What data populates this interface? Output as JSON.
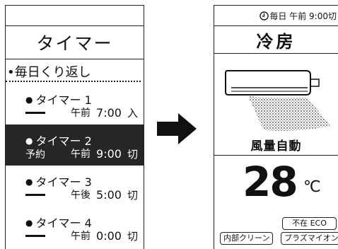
{
  "timer_screen": {
    "title": "タイマー",
    "repeat_label": "•毎日くり返し",
    "timers": [
      {
        "name": "タイマー 1",
        "reserve": "",
        "ampm": "午前",
        "time": "7:00",
        "action": "入",
        "selected": false
      },
      {
        "name": "タイマー 2",
        "reserve": "予約",
        "ampm": "午前",
        "time": "9:00",
        "action": "切",
        "selected": true
      },
      {
        "name": "タイマー 3",
        "reserve": "",
        "ampm": "午後",
        "time": "5:00",
        "action": "切",
        "selected": false
      },
      {
        "name": "タイマー 4",
        "reserve": "",
        "ampm": "午前",
        "time": "0:00",
        "action": "切",
        "selected": false
      }
    ]
  },
  "ac_screen": {
    "status": "毎日 午前 9:00切",
    "mode": "冷房",
    "fan": "風量自動",
    "temperature": "28",
    "unit": "℃",
    "badges": {
      "absent_eco": "不在 ECO",
      "internal_clean": "内部クリーン",
      "plasma_ion": "プラズマイオン"
    }
  },
  "colors": {
    "selected_bg": "#262626",
    "line": "#222222"
  }
}
